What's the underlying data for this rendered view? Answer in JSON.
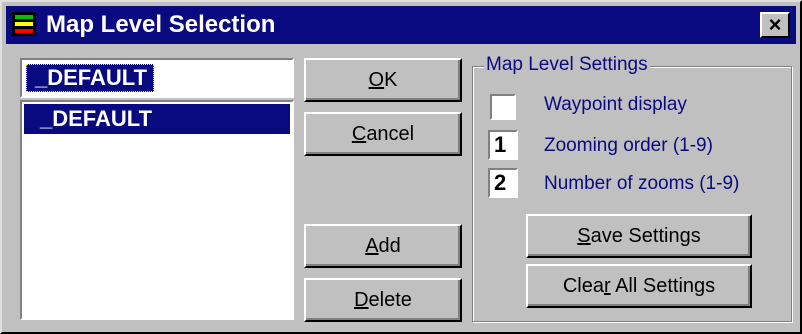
{
  "window": {
    "title": "Map Level Selection",
    "close_glyph": "×",
    "icon_colors": [
      "#00c000",
      "#ffff00",
      "#ff0000"
    ]
  },
  "name_input": {
    "value": "_DEFAULT"
  },
  "level_list": {
    "items": [
      "_DEFAULT"
    ]
  },
  "buttons": {
    "ok": {
      "mnemonic": "O",
      "rest": "K"
    },
    "cancel": {
      "mnemonic": "C",
      "rest": "ancel"
    },
    "add": {
      "mnemonic": "A",
      "rest": "dd"
    },
    "delete": {
      "mnemonic": "D",
      "rest": "elete"
    }
  },
  "settings": {
    "group_label": "Map Level Settings",
    "waypoint_label": "Waypoint display",
    "waypoint_checked": false,
    "zoom_order_value": "1",
    "zoom_order_label": "Zooming order (1-9)",
    "num_zooms_value": "2",
    "num_zooms_label": "Number of zooms (1-9)",
    "save_button": {
      "mnemonic": "S",
      "rest": "ave Settings"
    },
    "clear_button": {
      "before": "Clea",
      "mnemonic": "r",
      "after": " All Settings"
    }
  },
  "colors": {
    "titlebar": "#0a0a80",
    "face": "#c0c0c0",
    "label_text": "#0a0a80"
  }
}
